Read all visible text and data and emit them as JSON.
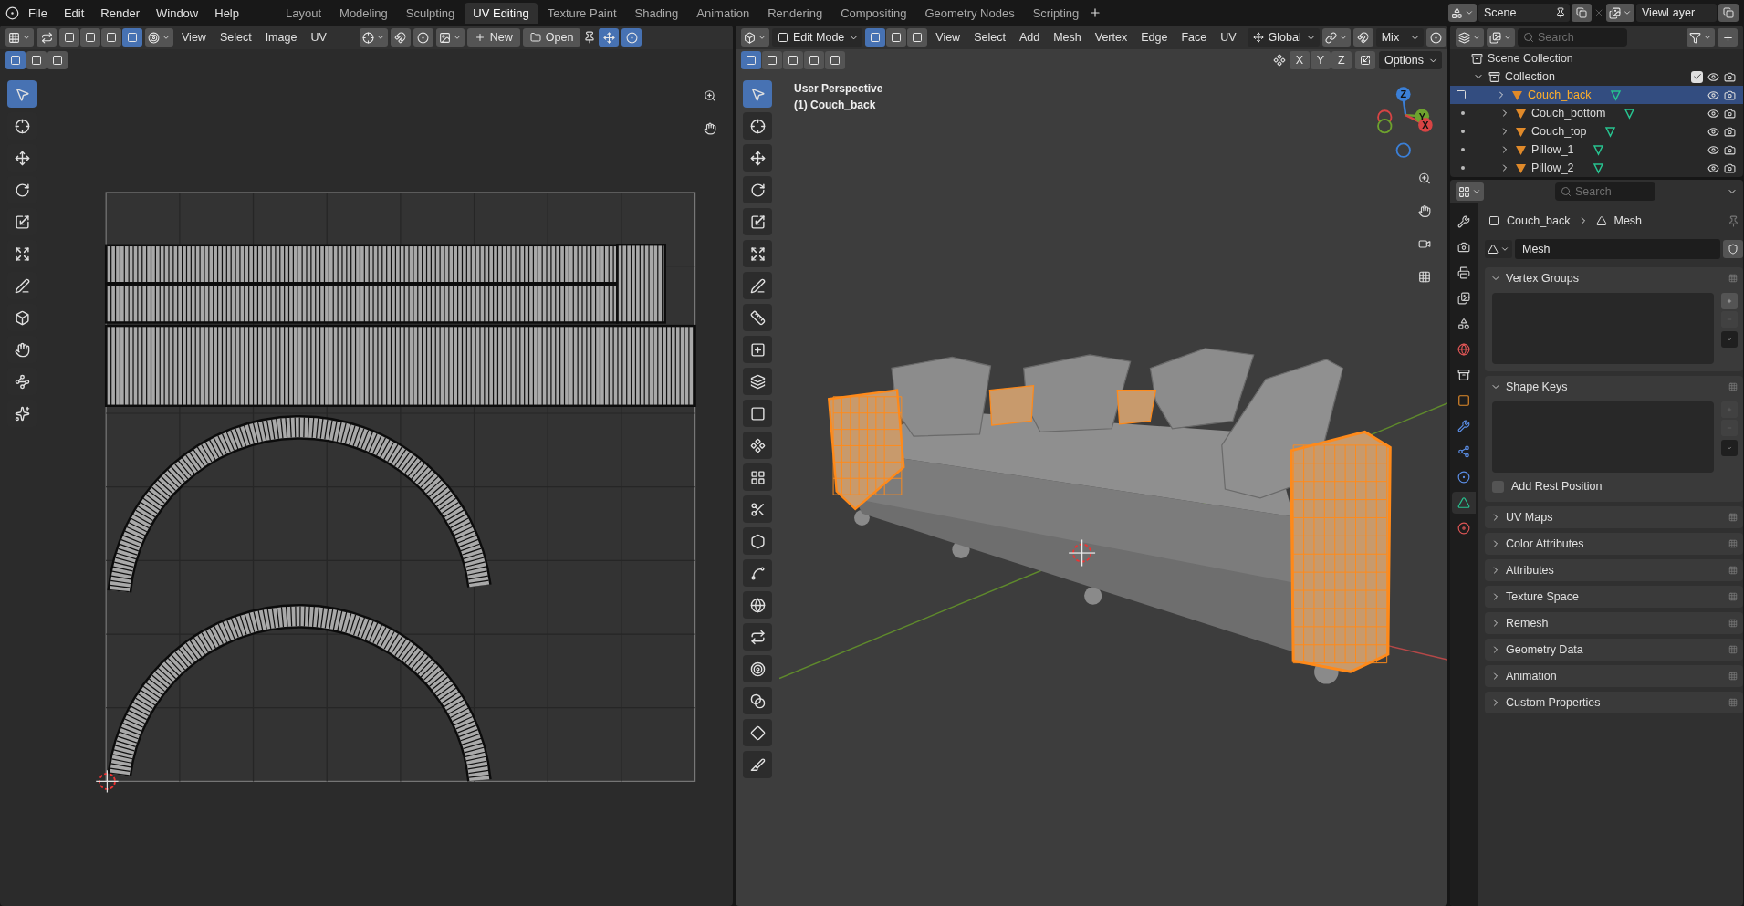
{
  "menu": [
    "File",
    "Edit",
    "Render",
    "Window",
    "Help"
  ],
  "workspaces": [
    {
      "label": "Layout",
      "selected": false
    },
    {
      "label": "Modeling",
      "selected": false
    },
    {
      "label": "Sculpting",
      "selected": false
    },
    {
      "label": "UV Editing",
      "selected": true
    },
    {
      "label": "Texture Paint",
      "selected": false
    },
    {
      "label": "Shading",
      "selected": false
    },
    {
      "label": "Animation",
      "selected": false
    },
    {
      "label": "Rendering",
      "selected": false
    },
    {
      "label": "Compositing",
      "selected": false
    },
    {
      "label": "Geometry Nodes",
      "selected": false
    },
    {
      "label": "Scripting",
      "selected": false
    }
  ],
  "scene": {
    "name": "Scene",
    "view_layer": "ViewLayer"
  },
  "uv_editor": {
    "select_modes": [
      {
        "selected": false
      },
      {
        "selected": false
      },
      {
        "selected": false
      },
      {
        "selected": true
      }
    ],
    "menus": [
      "View",
      "Select",
      "Image",
      "UV"
    ],
    "new_label": "New",
    "open_label": "Open",
    "box_modes": [
      {
        "selected": true
      },
      {
        "selected": false
      },
      {
        "selected": false
      }
    ],
    "tools": [
      {
        "selected": true
      },
      {
        "selected": false
      },
      {
        "selected": false
      },
      {
        "selected": false
      },
      {
        "selected": false
      },
      {
        "selected": false
      },
      {
        "selected": false
      },
      {
        "selected": false
      },
      {
        "selected": false
      },
      {
        "selected": false
      },
      {
        "selected": false
      }
    ]
  },
  "viewport": {
    "mode": "Edit Mode",
    "select_modes": [
      {
        "selected": true
      },
      {
        "selected": false
      },
      {
        "selected": false
      }
    ],
    "menus": [
      "View",
      "Select",
      "Add",
      "Mesh",
      "Vertex",
      "Edge",
      "Face",
      "UV"
    ],
    "orientation": "Global",
    "snap_target": "Mix",
    "box_modes": [
      {
        "selected": true
      },
      {
        "selected": false
      },
      {
        "selected": false
      },
      {
        "selected": false
      },
      {
        "selected": false
      }
    ],
    "axes": [
      {
        "label": "X",
        "selected": false
      },
      {
        "label": "Y",
        "selected": false
      },
      {
        "label": "Z",
        "selected": false
      }
    ],
    "options": "Options",
    "overlay": [
      "User Perspective",
      "(1) Couch_back"
    ],
    "gizmo_axes": [
      "Z",
      "Y",
      "X"
    ],
    "tools": [
      {
        "selected": true
      },
      {
        "selected": false
      },
      {
        "selected": false
      },
      {
        "selected": false
      },
      {
        "selected": false
      },
      {
        "selected": false
      },
      {
        "selected": false
      },
      {
        "selected": false
      },
      {
        "selected": false
      },
      {
        "selected": false
      },
      {
        "selected": false
      },
      {
        "selected": false
      },
      {
        "selected": false
      },
      {
        "selected": false
      },
      {
        "selected": false
      },
      {
        "selected": false
      },
      {
        "selected": false
      },
      {
        "selected": false
      },
      {
        "selected": false
      },
      {
        "selected": false
      },
      {
        "selected": false
      },
      {
        "selected": false
      }
    ]
  },
  "outliner": {
    "search_placeholder": "Search",
    "scene_collection": "Scene Collection",
    "collection": {
      "label": "Collection",
      "checked": true
    },
    "objects": [
      {
        "name": "Couch_back",
        "selected": true
      },
      {
        "name": "Couch_bottom",
        "selected": false
      },
      {
        "name": "Couch_top",
        "selected": false
      },
      {
        "name": "Pillow_1",
        "selected": false
      },
      {
        "name": "Pillow_2",
        "selected": false
      }
    ]
  },
  "properties": {
    "search_placeholder": "Search",
    "breadcrumb": [
      "Couch_back",
      "Mesh"
    ],
    "data_name": "Mesh",
    "tabs": [
      {
        "selected": false
      },
      {
        "selected": false
      },
      {
        "selected": false
      },
      {
        "selected": false
      },
      {
        "selected": false
      },
      {
        "selected": false
      },
      {
        "selected": false
      },
      {
        "selected": false
      },
      {
        "selected": false
      },
      {
        "selected": false
      },
      {
        "selected": false
      },
      {
        "selected": true
      },
      {
        "selected": false
      }
    ],
    "panels": [
      {
        "title": "Vertex Groups",
        "expanded": true,
        "can_add": true
      },
      {
        "title": "Shape Keys",
        "expanded": true,
        "can_add": false,
        "checkbox": {
          "label": "Add Rest Position",
          "checked": false
        }
      },
      {
        "title": "UV Maps",
        "expanded": false
      },
      {
        "title": "Color Attributes",
        "expanded": false
      },
      {
        "title": "Attributes",
        "expanded": false
      },
      {
        "title": "Texture Space",
        "expanded": false
      },
      {
        "title": "Remesh",
        "expanded": false
      },
      {
        "title": "Geometry Data",
        "expanded": false
      },
      {
        "title": "Animation",
        "expanded": false
      },
      {
        "title": "Custom Properties",
        "expanded": false
      }
    ]
  }
}
